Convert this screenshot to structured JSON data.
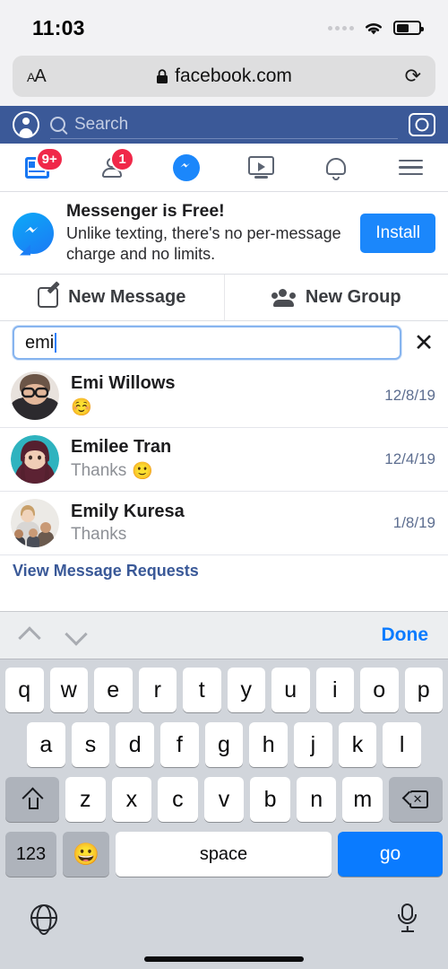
{
  "status_bar": {
    "time": "11:03",
    "wifi_icon": "wifi-icon",
    "battery_icon": "battery-icon",
    "signal_icon": "signal-dots-icon"
  },
  "browser": {
    "text_size_label": "AA",
    "lock_icon": "lock-icon",
    "url": "facebook.com",
    "reload_icon": "reload-icon"
  },
  "fb_header": {
    "profile_icon": "profile-avatar-icon",
    "search_icon": "search-icon",
    "search_placeholder": "Search",
    "camera_icon": "camera-icon"
  },
  "fb_nav": {
    "items": [
      {
        "name": "news-feed",
        "icon": "news-feed-icon",
        "badge": "9+",
        "active": true
      },
      {
        "name": "friend-requests",
        "icon": "friends-icon",
        "badge": "1",
        "active": false
      },
      {
        "name": "messenger",
        "icon": "messenger-icon",
        "badge": "",
        "active": true
      },
      {
        "name": "watch",
        "icon": "video-watch-icon",
        "badge": "",
        "active": false
      },
      {
        "name": "notifications",
        "icon": "bell-icon",
        "badge": "",
        "active": false
      },
      {
        "name": "menu",
        "icon": "hamburger-menu-icon",
        "badge": "",
        "active": false
      }
    ],
    "badge_color": "#f02849",
    "active_color": "#1877f2"
  },
  "banner": {
    "logo_icon": "messenger-logo-icon",
    "title": "Messenger is Free!",
    "subtitle": "Unlike texting, there's no per-message charge and no limits.",
    "button_label": "Install",
    "button_color": "#1b87fb"
  },
  "actions": {
    "new_message_label": "New Message",
    "new_message_icon": "compose-icon",
    "new_group_label": "New Group",
    "new_group_icon": "group-people-icon"
  },
  "search": {
    "value": "emi",
    "clear_icon": "clear-x-icon",
    "focus_color": "#86b4ef"
  },
  "results": [
    {
      "name": "Emi Willows",
      "preview": "",
      "emoji": "☺️",
      "date": "12/8/19",
      "avatar": "woman-glasses-avatar"
    },
    {
      "name": "Emilee Tran",
      "preview": "Thanks",
      "emoji": "🙂",
      "date": "12/4/19",
      "avatar": "woman-teal-hair-avatar"
    },
    {
      "name": "Emily Kuresa",
      "preview": "Thanks",
      "emoji": "",
      "date": "1/8/19",
      "avatar": "family-group-avatar"
    }
  ],
  "message_requests_label": "View Message Requests",
  "keyboard_accessory": {
    "prev_icon": "chevron-up-icon",
    "next_icon": "chevron-down-icon",
    "done_label": "Done",
    "done_color": "#0a7bff"
  },
  "keyboard": {
    "row1": [
      "q",
      "w",
      "e",
      "r",
      "t",
      "y",
      "u",
      "i",
      "o",
      "p"
    ],
    "row2": [
      "a",
      "s",
      "d",
      "f",
      "g",
      "h",
      "j",
      "k",
      "l"
    ],
    "row3": [
      "z",
      "x",
      "c",
      "v",
      "b",
      "n",
      "m"
    ],
    "shift_icon": "shift-key-icon",
    "delete_icon": "backspace-key-icon",
    "numbers_label": "123",
    "emoji_label": "😀",
    "space_label": "space",
    "go_label": "go",
    "go_color": "#0a7bff",
    "globe_icon": "globe-key-icon",
    "mic_icon": "microphone-key-icon"
  }
}
